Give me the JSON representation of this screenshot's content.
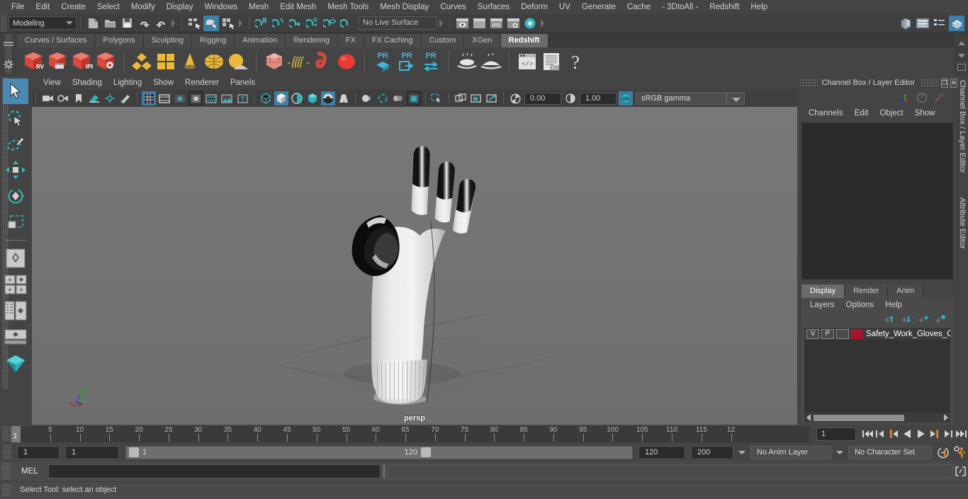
{
  "menubar": {
    "items": [
      "File",
      "Edit",
      "Create",
      "Select",
      "Modify",
      "Display",
      "Windows",
      "Mesh",
      "Edit Mesh",
      "Mesh Tools",
      "Mesh Display",
      "Curves",
      "Surfaces",
      "Deform",
      "UV",
      "Generate",
      "Cache",
      "- 3DtoAll -",
      "Redshift",
      "Help"
    ]
  },
  "statusline": {
    "menuset": "Modeling",
    "live_surface": "No Live Surface"
  },
  "shelf": {
    "tabs": [
      "Curves / Surfaces",
      "Polygons",
      "Sculpting",
      "Rigging",
      "Animation",
      "Rendering",
      "FX",
      "FX Caching",
      "Custom",
      "XGen",
      "Redshift"
    ],
    "active_tab": "Redshift",
    "buttons": [
      "RV",
      "render-sequence",
      "IPR",
      "render-settings",
      "subdivide",
      "multi-tile",
      "cone-proxy",
      "sphere-proxy",
      "dome-light",
      "volume-cube",
      "hair-strands",
      "curve-tool",
      "sphere-red",
      "PR-cube",
      "PR-export",
      "PR-convert",
      "bake-ao",
      "bake-lm",
      "script-editor",
      "log-file",
      "help"
    ]
  },
  "viewport": {
    "menus": [
      "View",
      "Shading",
      "Lighting",
      "Show",
      "Renderer",
      "Panels"
    ],
    "exposure": "0.00",
    "gamma_value": "1.00",
    "color_management": "sRGB gamma",
    "camera_label": "persp",
    "axis": {
      "x": "x",
      "y": "y",
      "z": "z"
    }
  },
  "toolbox": {
    "tools": [
      "select-tool",
      "lasso-select-tool",
      "paint-select-tool",
      "move-tool",
      "rotate-tool",
      "scale-tool",
      "last-tool",
      "snap-grid",
      "snap-curve",
      "snap-point",
      "snap-view",
      "layout-single",
      "layout-two-pane",
      "layout-hypergraph",
      "layout-outliner"
    ],
    "selected": "select-tool"
  },
  "channelbox": {
    "title": "Channel Box / Layer Editor",
    "menus": [
      "Channels",
      "Edit",
      "Object",
      "Show"
    ],
    "side_tabs": [
      "Channel Box / Layer Editor",
      "Attribute Editor"
    ],
    "close_glyph": "✕",
    "restore_glyph": "❐"
  },
  "layereditor": {
    "tabs": [
      "Display",
      "Render",
      "Anim"
    ],
    "active_tab": "Display",
    "menus": [
      "Layers",
      "Options",
      "Help"
    ],
    "layers": [
      {
        "visibility": "V",
        "playback": "P",
        "shading": "",
        "color": "#b01030",
        "name": "Safety_Work_Gloves_C"
      }
    ]
  },
  "timeslider": {
    "current_frame": "1",
    "current_frame_field": "1",
    "tick_labels": [
      "5",
      "10",
      "15",
      "20",
      "25",
      "30",
      "35",
      "40",
      "45",
      "50",
      "55",
      "60",
      "65",
      "70",
      "75",
      "80",
      "85",
      "90",
      "95",
      "100",
      "105",
      "110",
      "115",
      "12"
    ],
    "playback_buttons": [
      "go-to-start",
      "step-back-key",
      "step-back-frame",
      "play-backwards",
      "play-forwards",
      "step-forward-frame",
      "step-forward-key",
      "go-to-end"
    ]
  },
  "rangeslider": {
    "anim_start": "1",
    "range_start": "1",
    "slider_start_label": "1",
    "slider_end_label": "120",
    "range_end": "120",
    "anim_end": "200",
    "anim_layer": "No Anim Layer",
    "character_set": "No Character Set"
  },
  "commandline": {
    "language_label": "MEL",
    "input_value": "",
    "output_value": ""
  },
  "statusbar": {
    "message": "Select Tool: select an object"
  },
  "colors": {
    "accent_blue": "#3e7fa8",
    "highlight_teal": "#27b3c0",
    "shelf_red": "#d64a3e",
    "shelf_yellow": "#e8b33c",
    "layer_red": "#b01030",
    "viewport_bg": "#737373",
    "panel_bg": "#444444"
  }
}
